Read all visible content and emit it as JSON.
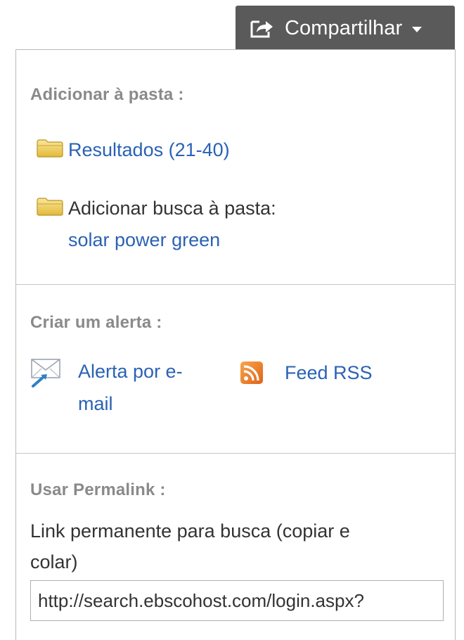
{
  "share_button": {
    "label": "Compartilhar",
    "icon": "share-icon"
  },
  "folder_section": {
    "heading": "Adicionar à pasta :",
    "results_link": "Resultados (21-40)",
    "add_search_label": "Adicionar busca à pasta:",
    "search_query_link": "solar power green"
  },
  "alert_section": {
    "heading": "Criar um alerta :",
    "email_alert_line1": "Alerta por e-",
    "email_alert_line2": "mail",
    "rss_feed_link": "Feed RSS"
  },
  "permalink_section": {
    "heading": "Usar Permalink :",
    "description_line1": "Link permanente para busca (copiar e",
    "description_line2": "colar)",
    "url_value": "http://search.ebscohost.com/login.aspx?"
  },
  "colors": {
    "link": "#2a62b4",
    "heading": "#8a8a8a",
    "button_bg": "#5a5a5a",
    "rss_orange": "#f0871e",
    "folder_yellow": "#f2cf4e"
  }
}
